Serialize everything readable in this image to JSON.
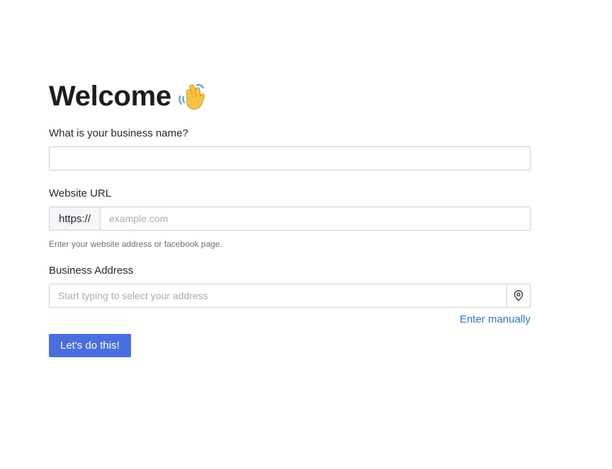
{
  "header": {
    "title": "Welcome",
    "title_icon": "waving-hand-icon"
  },
  "form": {
    "business_name": {
      "label": "What is your business name?",
      "value": "",
      "placeholder": ""
    },
    "website": {
      "label": "Website URL",
      "prefix": "https://",
      "value": "",
      "placeholder": "example.com",
      "help": "Enter your website address or facebook page."
    },
    "address": {
      "label": "Business Address",
      "value": "",
      "placeholder": "Start typing to select your address",
      "button_icon": "location-pin-icon",
      "manual_link": "Enter manually"
    },
    "submit_label": "Let's do this!"
  },
  "colors": {
    "accent": "#4a6ee0",
    "link": "#2f74d0",
    "border": "#cdd2d7"
  }
}
